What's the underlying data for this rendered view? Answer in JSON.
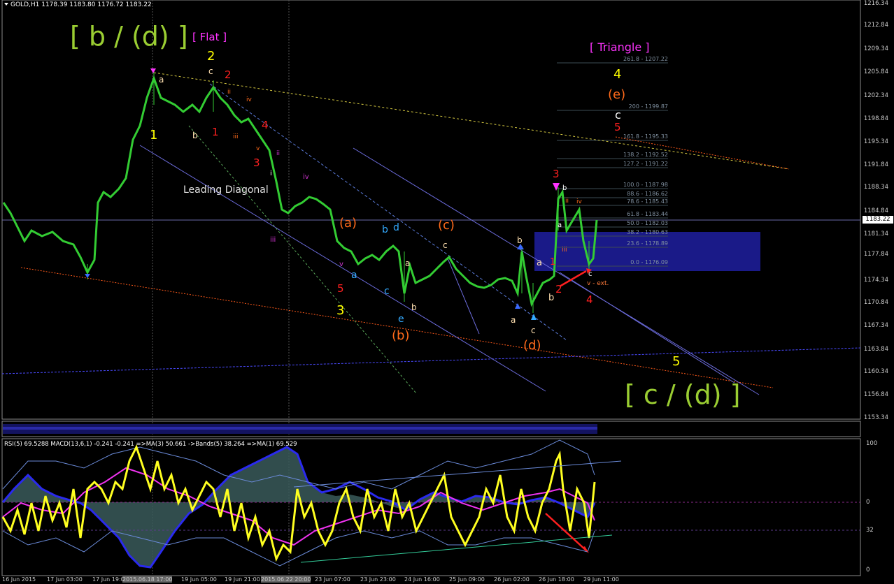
{
  "chart": {
    "symbol_header": "GOLD,H1  1178.39 1183.80 1176.72 1183.22",
    "current_price": "1183.22",
    "price_axis": [
      "1216.34",
      "1212.84",
      "1209.34",
      "1205.84",
      "1202.34",
      "1198.84",
      "1195.34",
      "1191.84",
      "1188.34",
      "1184.84",
      "1181.34",
      "1177.84",
      "1174.34",
      "1170.84",
      "1167.34",
      "1163.84",
      "1160.34",
      "1156.84",
      "1153.34"
    ],
    "time_axis": [
      "16 Jun 2015",
      "17 Jun 03:00",
      "17 Jun 19:00",
      "2015.06.18 17:00",
      "19 Jun 05:00",
      "19 Jun 21:00",
      "2015.06.22 20:00",
      "23 Jun 07:00",
      "23 Jun 23:00",
      "24 Jun 16:00",
      "25 Jun 09:00",
      "26 Jun 02:00",
      "26 Jun 18:00",
      "29 Jun 11:00"
    ],
    "annotations": {
      "b_d": "[ b / (d) ]",
      "flat": "[ Flat ]",
      "triangle": "[ Triangle ]",
      "c_d": "[ c / (d) ]",
      "leading_diagonal": "Leading Diagonal",
      "v_ext": "v - ext."
    },
    "fib_levels": [
      "261.8 - 1207.22",
      "200 - 1199.87",
      "161.8 - 1195.33",
      "138.2 - 1192.52",
      "127.2 - 1191.22",
      "100.0 - 1187.98",
      "88.6 - 1186.62",
      "78.6 - 1185.43",
      "61.8 - 1183.44",
      "50.0 - 1182.03",
      "38.2 - 1180.63",
      "23.6 - 1178.89",
      "0.0 - 1176.09"
    ]
  },
  "indicator": {
    "title": "RSI(5) 69.5288  MACD(13,6,1) -0.241 -0.241  =>MA(3) 50.661  ->Bands(5) 38.264  =>MA(1) 69.529",
    "scale": [
      "100",
      "0",
      "32",
      "0"
    ]
  },
  "colors": {
    "background": "#000000",
    "candle": "#33cc33",
    "axis": "#cccccc",
    "yellow": "#ffff00",
    "green_label": "#9acd32",
    "magenta": "#ff33ff",
    "red": "#ff2020",
    "orange": "#ff6a1a",
    "cyan": "#33aaff"
  }
}
